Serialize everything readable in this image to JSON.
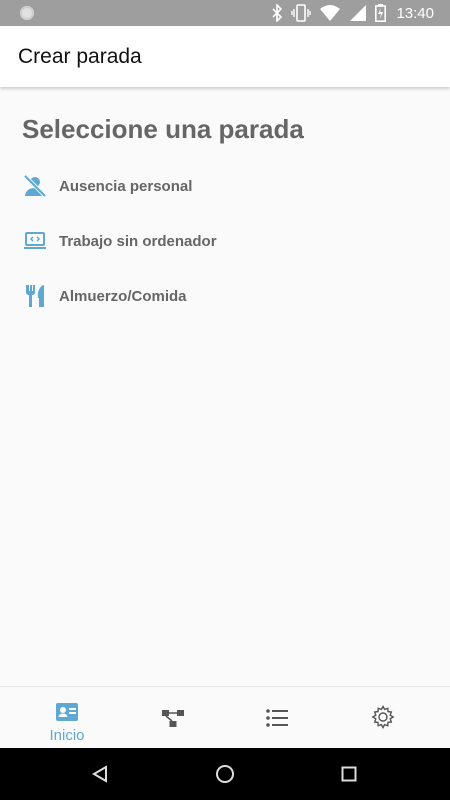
{
  "status_bar": {
    "time": "13:40",
    "icons": [
      "notification-dot-icon",
      "bluetooth-icon",
      "vibrate-icon",
      "wifi-icon",
      "signal-icon",
      "battery-icon"
    ]
  },
  "app_bar": {
    "title": "Crear parada"
  },
  "main": {
    "heading": "Seleccione una parada",
    "stops": [
      {
        "label": "Ausencia personal",
        "icon": "person-off-icon"
      },
      {
        "label": "Trabajo sin ordenador",
        "icon": "laptop-code-icon"
      },
      {
        "label": "Almuerzo/Comida",
        "icon": "utensils-icon"
      }
    ]
  },
  "bottom_nav": {
    "items": [
      {
        "label": "Inicio",
        "icon": "id-card-icon",
        "active": true
      },
      {
        "label": "",
        "icon": "network-icon",
        "active": false
      },
      {
        "label": "",
        "icon": "list-icon",
        "active": false
      },
      {
        "label": "",
        "icon": "gear-icon",
        "active": false
      }
    ]
  },
  "colors": {
    "accent": "#5fa8d3",
    "text_muted": "#666666",
    "status_bar": "#9e9e9e"
  }
}
